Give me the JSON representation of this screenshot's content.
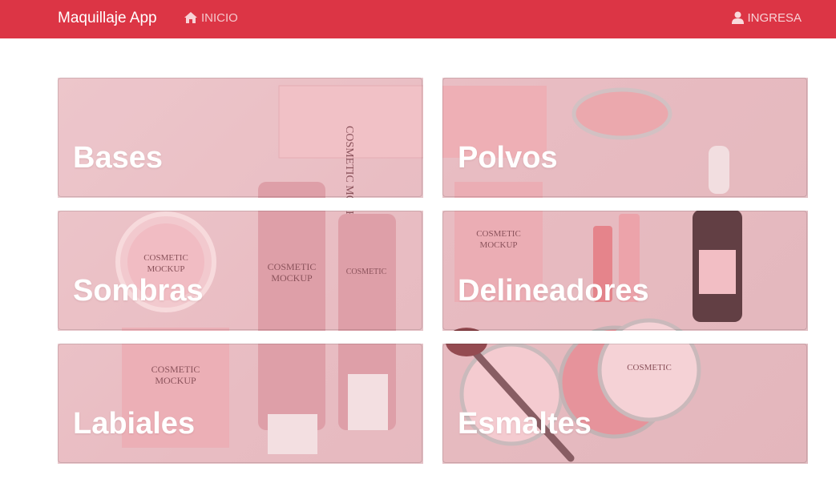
{
  "navbar": {
    "brand": "Maquillaje App",
    "home_label": "INICIO",
    "login_label": "INGRESA",
    "color": "#dc3545",
    "home_icon": "home-icon",
    "login_icon": "user-icon"
  },
  "categories": [
    {
      "title": "Bases"
    },
    {
      "title": "Polvos"
    },
    {
      "title": "Sombras"
    },
    {
      "title": "Delineadores"
    },
    {
      "title": "Labiales"
    },
    {
      "title": "Esmaltes"
    }
  ]
}
